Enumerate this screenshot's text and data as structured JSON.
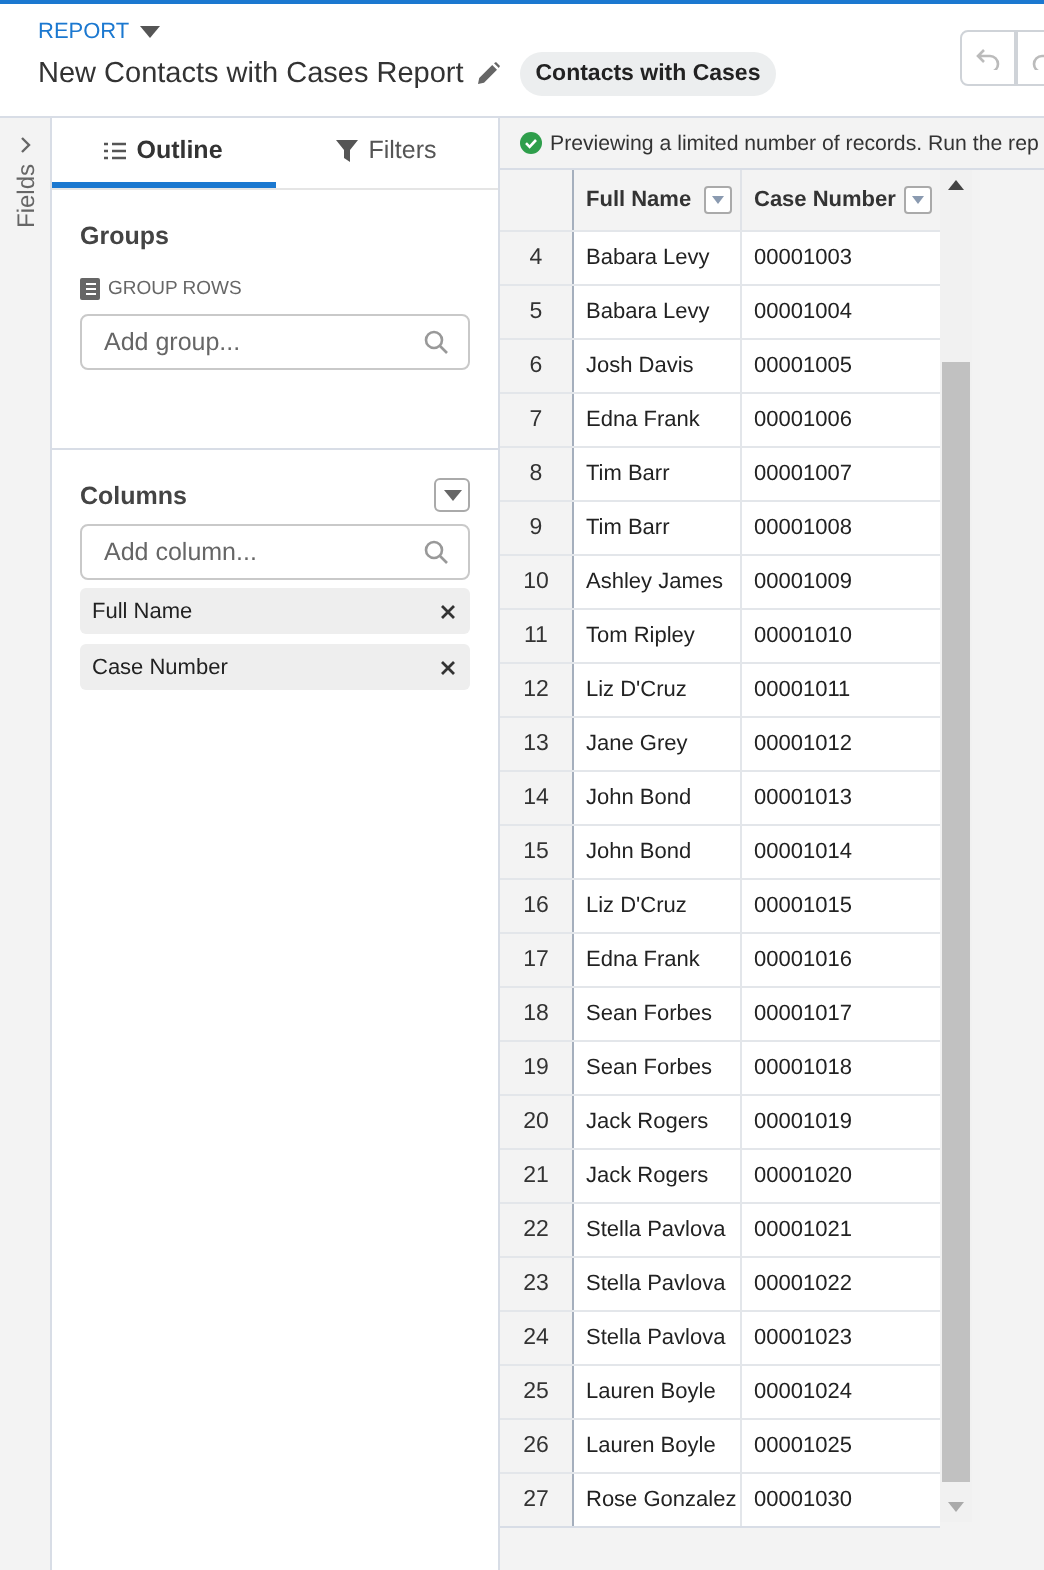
{
  "header": {
    "breadcrumb": "REPORT",
    "title": "New Contacts with Cases Report",
    "report_type": "Contacts with Cases"
  },
  "fields_toggle": {
    "label": "Fields"
  },
  "tabs": [
    {
      "label": "Outline",
      "selected": true
    },
    {
      "label": "Filters",
      "selected": false
    }
  ],
  "groups": {
    "heading": "Groups",
    "subheading": "GROUP ROWS",
    "search": {
      "placeholder": "Add group..."
    }
  },
  "columns_panel": {
    "heading": "Columns",
    "search": {
      "placeholder": "Add column..."
    },
    "items": [
      "Full Name",
      "Case Number"
    ]
  },
  "preview": {
    "message": "Previewing a limited number of records. Run the rep"
  },
  "table": {
    "columns": [
      "Full Name",
      "Case Number"
    ],
    "rows": [
      {
        "n": "4",
        "name": "Babara Levy",
        "case": "00001003"
      },
      {
        "n": "5",
        "name": "Babara Levy",
        "case": "00001004"
      },
      {
        "n": "6",
        "name": "Josh Davis",
        "case": "00001005"
      },
      {
        "n": "7",
        "name": "Edna Frank",
        "case": "00001006"
      },
      {
        "n": "8",
        "name": "Tim Barr",
        "case": "00001007"
      },
      {
        "n": "9",
        "name": "Tim Barr",
        "case": "00001008"
      },
      {
        "n": "10",
        "name": "Ashley James",
        "case": "00001009"
      },
      {
        "n": "11",
        "name": "Tom Ripley",
        "case": "00001010"
      },
      {
        "n": "12",
        "name": "Liz D'Cruz",
        "case": "00001011"
      },
      {
        "n": "13",
        "name": "Jane Grey",
        "case": "00001012"
      },
      {
        "n": "14",
        "name": "John Bond",
        "case": "00001013"
      },
      {
        "n": "15",
        "name": "John Bond",
        "case": "00001014"
      },
      {
        "n": "16",
        "name": "Liz D'Cruz",
        "case": "00001015"
      },
      {
        "n": "17",
        "name": "Edna Frank",
        "case": "00001016"
      },
      {
        "n": "18",
        "name": "Sean Forbes",
        "case": "00001017"
      },
      {
        "n": "19",
        "name": "Sean Forbes",
        "case": "00001018"
      },
      {
        "n": "20",
        "name": "Jack Rogers",
        "case": "00001019"
      },
      {
        "n": "21",
        "name": "Jack Rogers",
        "case": "00001020"
      },
      {
        "n": "22",
        "name": "Stella Pavlova",
        "case": "00001021"
      },
      {
        "n": "23",
        "name": "Stella Pavlova",
        "case": "00001022"
      },
      {
        "n": "24",
        "name": "Stella Pavlova",
        "case": "00001023"
      },
      {
        "n": "25",
        "name": "Lauren Boyle",
        "case": "00001024"
      },
      {
        "n": "26",
        "name": "Lauren Boyle",
        "case": "00001025"
      },
      {
        "n": "27",
        "name": "Rose Gonzalez",
        "case": "00001030"
      }
    ]
  }
}
